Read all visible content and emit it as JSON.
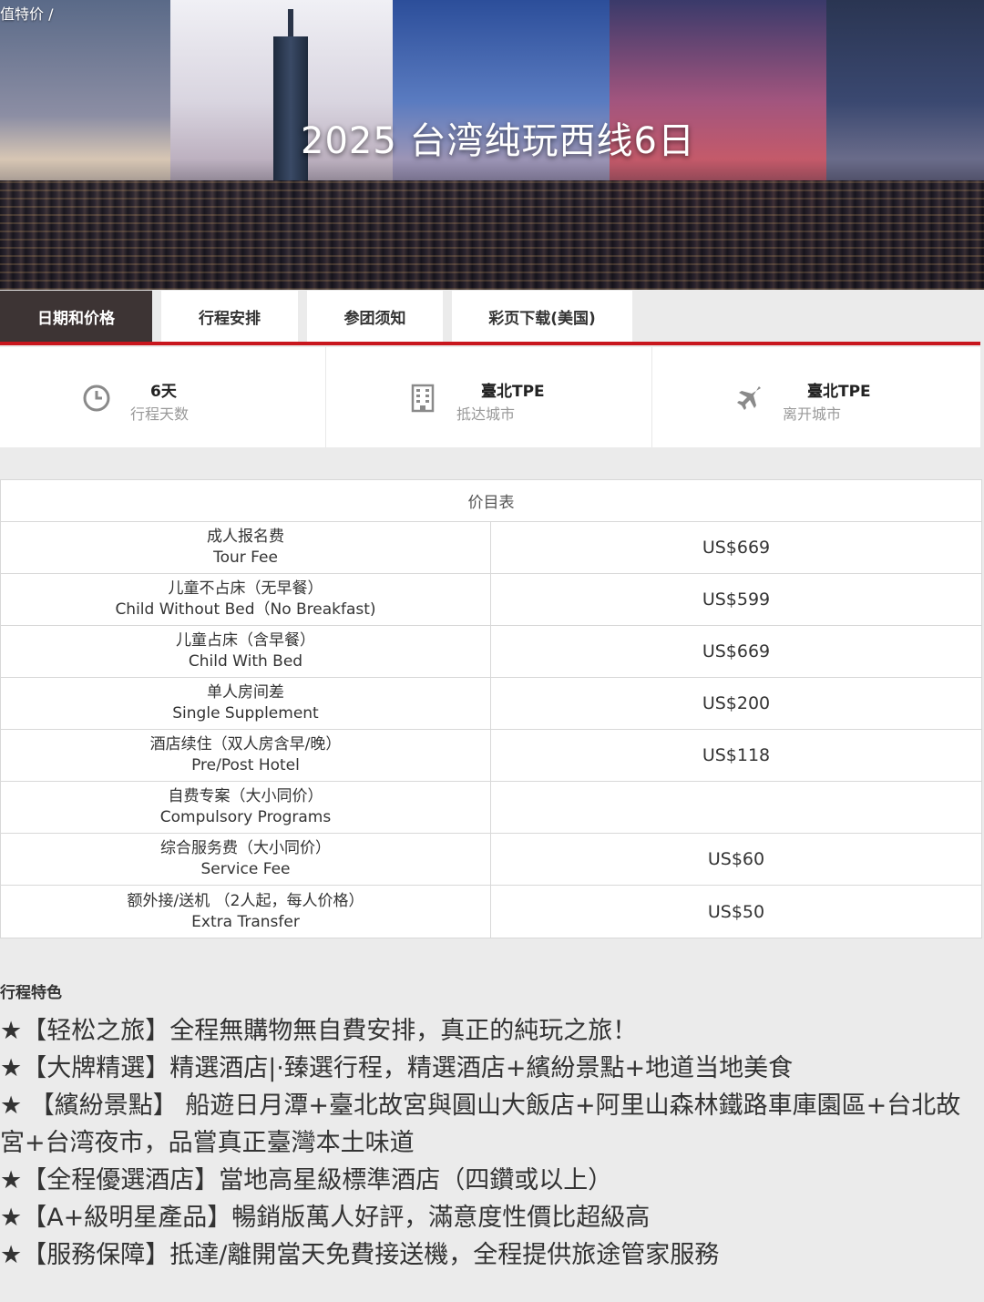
{
  "breadcrumb": "值特价  /",
  "hero": {
    "title": "2025 台湾纯玩西线6日"
  },
  "tabs": [
    {
      "label": "日期和价格",
      "active": true
    },
    {
      "label": "行程安排",
      "active": false
    },
    {
      "label": "参团须知",
      "active": false
    },
    {
      "label": "彩页下载(美国)",
      "active": false
    }
  ],
  "info": [
    {
      "icon": "clock-icon",
      "value": "6天",
      "label": "行程天数"
    },
    {
      "icon": "building-icon",
      "value": "臺北TPE",
      "label": "抵达城市"
    },
    {
      "icon": "airplane-icon",
      "value": "臺北TPE",
      "label": "离开城市"
    }
  ],
  "price_table": {
    "header": "价目表",
    "rows": [
      {
        "name_cn": "成人报名费",
        "name_en": "Tour Fee",
        "price": "US$669"
      },
      {
        "name_cn": "儿童不占床（无早餐）",
        "name_en": "Child Without Bed（No Breakfast)",
        "price": "US$599"
      },
      {
        "name_cn": "儿童占床（含早餐）",
        "name_en": "Child With Bed",
        "price": "US$669"
      },
      {
        "name_cn": "单人房间差",
        "name_en": "Single Supplement",
        "price": "US$200"
      },
      {
        "name_cn": "酒店续住（双人房含早/晚）",
        "name_en": "Pre/Post Hotel",
        "price": "US$118"
      },
      {
        "name_cn": "自费专案（大小同价）",
        "name_en": "Compulsory Programs",
        "price": ""
      },
      {
        "name_cn": "综合服务费（大小同价）",
        "name_en": "Service Fee",
        "price": "US$60"
      },
      {
        "name_cn": "额外接/送机 （2人起，每人价格）",
        "name_en": "Extra Transfer",
        "price": "US$50"
      }
    ]
  },
  "features": {
    "title": "行程特色",
    "items": [
      "★【轻松之旅】全程無購物無自費安排，真正的純玩之旅！",
      "★【大牌精選】精選酒店|·臻選行程，精選酒店+繽紛景點+地道当地美食",
      "★ 【繽紛景點】 船遊日月潭+臺北故宮與圓山大飯店+阿里山森林鐵路車庫園區+台北故宮+台湾夜市，品嘗真正臺灣本土味道",
      "★【全程優選酒店】當地高星級標準酒店（四鑽或以上）",
      "★【A+級明星產品】暢銷版萬人好評，滿意度性價比超級高",
      "★【服務保障】抵達/離開當天免費接送機，全程提供旅途管家服務"
    ]
  },
  "colors": {
    "accent_red": "#c8161d",
    "active_tab_bg": "#3d3434",
    "page_bg": "#ebebeb"
  }
}
